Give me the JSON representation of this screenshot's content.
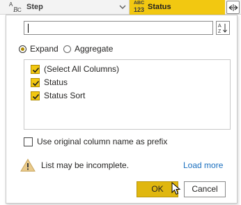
{
  "header": {
    "step_column": {
      "type_top": "A",
      "type_sub": "B",
      "type_bot": "C",
      "label": "Step"
    },
    "status_column": {
      "type_abc": "ABC",
      "type_123": "123",
      "label": "Status"
    }
  },
  "dialog": {
    "search": {
      "value": "",
      "placeholder": ""
    },
    "modes": {
      "expand": "Expand",
      "aggregate": "Aggregate",
      "selected": "expand"
    },
    "columns": [
      {
        "label": "(Select All Columns)",
        "checked": true
      },
      {
        "label": "Status",
        "checked": true
      },
      {
        "label": "Status Sort",
        "checked": true
      }
    ],
    "prefix_option": {
      "label": "Use original column name as prefix",
      "checked": false
    },
    "warning": {
      "text": "List may be incomplete.",
      "link": "Load more"
    },
    "buttons": {
      "ok": "OK",
      "cancel": "Cancel"
    }
  },
  "colors": {
    "accent": "#f2c811",
    "ok_button": "#e0b70f",
    "link": "#1a6fbf"
  }
}
